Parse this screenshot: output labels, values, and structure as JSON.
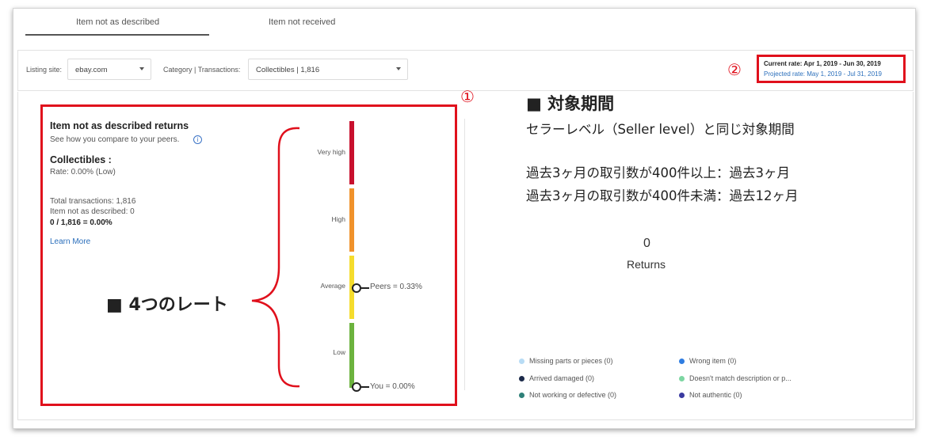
{
  "tabs": [
    {
      "label": "Item not as described",
      "active": true
    },
    {
      "label": "Item not received",
      "active": false
    }
  ],
  "filters": {
    "listing_site_label": "Listing site:",
    "listing_site_value": "ebay.com",
    "category_label": "Category | Transactions:",
    "category_value": "Collectibles | 1,816"
  },
  "rates": {
    "current": "Current rate: Apr 1, 2019 - Jun 30, 2019",
    "projected": "Projected rate: May 1, 2019 - Jul 31, 2019"
  },
  "annotations": {
    "num1": "①",
    "num2": "②",
    "four_rates": "■ 4つのレート",
    "period_title": "■ 対象期間",
    "period_lines": [
      "セラーレベル（Seller level）と同じ対象期間",
      "過去3ヶ月の取引数が400件以上：過去3ヶ月",
      "過去3ヶ月の取引数が400件未満：過去12ヶ月"
    ]
  },
  "summary": {
    "title": "Item not as described returns",
    "subtitle": "See how you compare to your peers.",
    "category": "Collectibles :",
    "rate": "Rate: 0.00% (Low)",
    "total": "Total transactions: 1,816",
    "inad": "Item not as described: 0",
    "calc": "0 / 1,816 = 0.00%",
    "learn_more": "Learn More"
  },
  "scale": {
    "levels": [
      {
        "label": "Very high",
        "color": "#c8102e"
      },
      {
        "label": "High",
        "color": "#f0922b"
      },
      {
        "label": "Average",
        "color": "#f5dc2d"
      },
      {
        "label": "Low",
        "color": "#6cb33e"
      }
    ],
    "peers": "Peers = 0.33%",
    "you": "You = 0.00%"
  },
  "returns": {
    "count": "0",
    "label": "Returns"
  },
  "legend": [
    {
      "label": "Missing parts or pieces (0)",
      "color": "#b8dcf5"
    },
    {
      "label": "Wrong item (0)",
      "color": "#2f7de1"
    },
    {
      "label": "Arrived damaged (0)",
      "color": "#1c2a4a"
    },
    {
      "label": "Doesn't match description or p...",
      "color": "#7dd6a2"
    },
    {
      "label": "Not working or defective (0)",
      "color": "#2e8078"
    },
    {
      "label": "Not authentic (0)",
      "color": "#3a3aa0"
    }
  ]
}
